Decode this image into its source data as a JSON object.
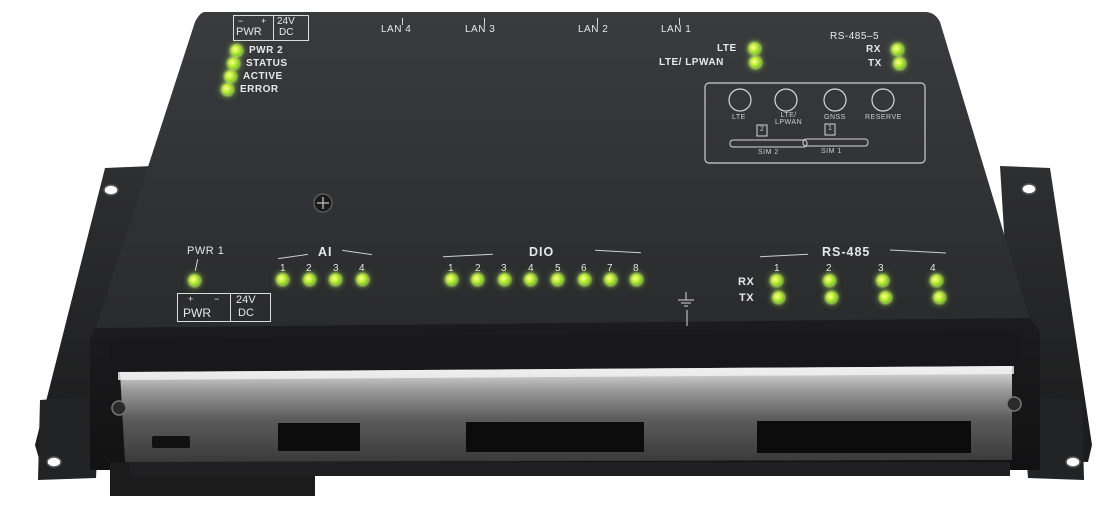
{
  "top_ports": {
    "lan": [
      "LAN 4",
      "LAN 3",
      "LAN 2",
      "LAN 1"
    ],
    "pwr_top": {
      "minus": "−",
      "plus": "+",
      "pwr": "PWR",
      "volt": "24V",
      "dc": "DC"
    }
  },
  "status_leds": [
    "PWR 2",
    "STATUS",
    "ACTIVE",
    "ERROR"
  ],
  "lte_leds": [
    "LTE",
    "LTE/ LPWAN"
  ],
  "rs485_5": {
    "title": "RS-485–5",
    "rx": "RX",
    "tx": "TX"
  },
  "antenna": {
    "connectors": [
      "LTE",
      "LTE/\nLPWAN",
      "GNSS",
      "RESERVE"
    ],
    "sims": [
      {
        "num": "2",
        "label": "SIM 2"
      },
      {
        "num": "1",
        "label": "SIM 1"
      }
    ]
  },
  "pwr1": {
    "label": "PWR 1",
    "plus": "+",
    "minus": "−",
    "pwr": "PWR",
    "volt": "24V",
    "dc": "DC"
  },
  "ai": {
    "title": "AI",
    "channels": [
      "1",
      "2",
      "3",
      "4"
    ]
  },
  "dio": {
    "title": "DIO",
    "channels": [
      "1",
      "2",
      "3",
      "4",
      "5",
      "6",
      "7",
      "8"
    ]
  },
  "rs485": {
    "title": "RS-485",
    "rx": "RX",
    "tx": "TX",
    "channels": [
      "1",
      "2",
      "3",
      "4"
    ]
  },
  "colors": {
    "body": "#2b2c2e",
    "led": "#b6ec3a",
    "text": "#e8e8e8"
  }
}
